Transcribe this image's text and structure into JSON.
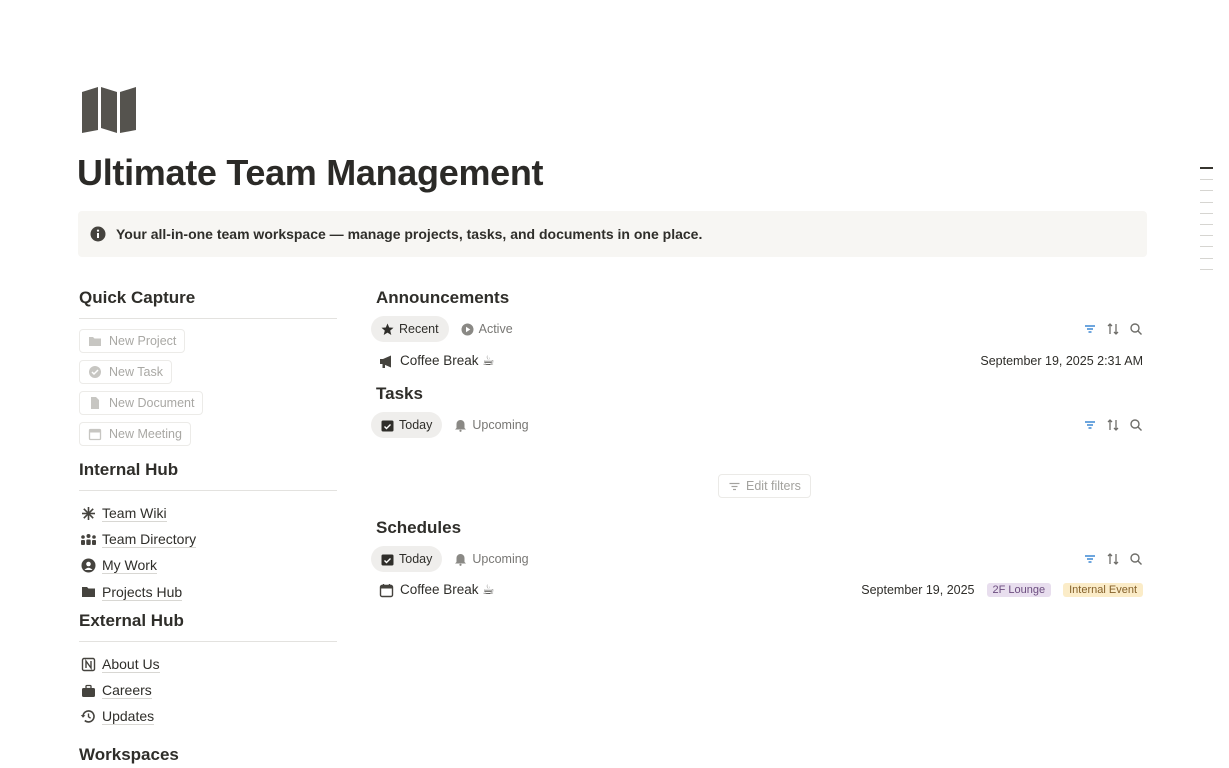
{
  "page": {
    "icon": "map-icon",
    "title": "Ultimate Team Management",
    "callout": {
      "icon": "info-icon",
      "text": "Your all-in-one team workspace — manage projects, tasks, and documents in one place."
    }
  },
  "quick_capture": {
    "heading": "Quick Capture",
    "buttons": [
      {
        "label": "New Project",
        "icon": "folder-icon"
      },
      {
        "label": "New Task",
        "icon": "check-circle-icon"
      },
      {
        "label": "New Document",
        "icon": "document-icon"
      },
      {
        "label": "New Meeting",
        "icon": "calendar-icon"
      }
    ]
  },
  "internal_hub": {
    "heading": "Internal Hub",
    "items": [
      {
        "label": "Team Wiki",
        "icon": "asterisk-icon"
      },
      {
        "label": "Team Directory",
        "icon": "people-icon"
      },
      {
        "label": "My Work",
        "icon": "user-circle-icon"
      },
      {
        "label": "Projects Hub",
        "icon": "folder-icon"
      }
    ]
  },
  "external_hub": {
    "heading": "External Hub",
    "items": [
      {
        "label": "About Us",
        "icon": "notion-logo-icon"
      },
      {
        "label": "Careers",
        "icon": "briefcase-icon"
      },
      {
        "label": "Updates",
        "icon": "history-icon"
      }
    ]
  },
  "workspaces": {
    "heading": "Workspaces"
  },
  "announcements": {
    "title": "Announcements",
    "tabs": [
      {
        "label": "Recent",
        "icon": "star-icon",
        "active": true
      },
      {
        "label": "Active",
        "icon": "play-circle-icon",
        "active": false
      }
    ],
    "rows": [
      {
        "name": "Coffee Break ☕",
        "icon": "megaphone-icon",
        "date": "September 19, 2025 2:31 AM"
      }
    ]
  },
  "tasks": {
    "title": "Tasks",
    "tabs": [
      {
        "label": "Today",
        "icon": "calendar-check-icon",
        "active": true
      },
      {
        "label": "Upcoming",
        "icon": "bell-icon",
        "active": false
      }
    ],
    "edit_filters_label": "Edit filters"
  },
  "schedules": {
    "title": "Schedules",
    "tabs": [
      {
        "label": "Today",
        "icon": "calendar-check-icon",
        "active": true
      },
      {
        "label": "Upcoming",
        "icon": "bell-icon",
        "active": false
      }
    ],
    "rows": [
      {
        "name": "Coffee Break ☕",
        "icon": "calendar-icon",
        "date": "September 19, 2025",
        "location": "2F Lounge",
        "category": "Internal Event"
      }
    ]
  },
  "colors": {
    "location_tag_bg": "#e8deee",
    "location_tag_fg": "#6c4d7f",
    "category_tag_bg": "#fbecc8",
    "category_tag_fg": "#85612a",
    "filter_icon": "#2f7fcf"
  }
}
